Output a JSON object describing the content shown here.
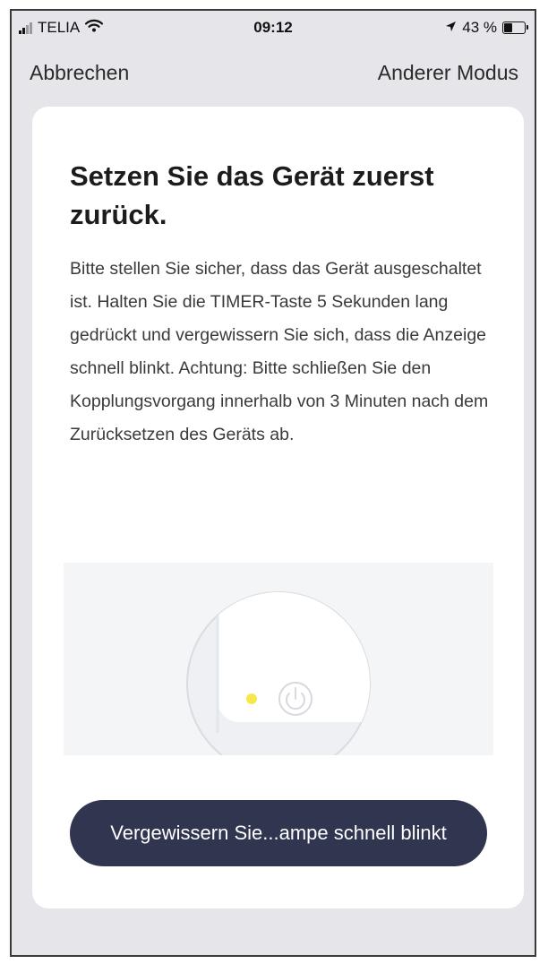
{
  "status_bar": {
    "carrier": "TELIA",
    "time": "09:12",
    "battery": "43 %",
    "battery_level": 0.43
  },
  "nav": {
    "cancel_label": "Abbrechen",
    "other_mode_label": "Anderer Modus"
  },
  "card": {
    "title": "Setzen Sie das Gerät zuerst zurück.",
    "body": "Bitte stellen Sie sicher, dass das Gerät ausgeschaltet ist. Halten Sie die TIMER-Taste 5 Sekunden lang gedrückt und vergewissern Sie sich, dass die Anzeige schnell blinkt. Achtung: Bitte schließen Sie den Kopplungsvorgang innerhalb von 3 Minuten nach dem Zurücksetzen des Geräts ab.",
    "confirm_button": "Vergewissern Sie...ampe schnell blinkt"
  },
  "colors": {
    "background": "#e5e5ea",
    "card": "#ffffff",
    "button": "#303550",
    "indicator_led": "#f5e84a"
  },
  "icons": {
    "signal": "cellular-signal-icon",
    "wifi": "wifi-icon",
    "location": "location-arrow-icon",
    "battery": "battery-icon",
    "power": "power-icon"
  }
}
